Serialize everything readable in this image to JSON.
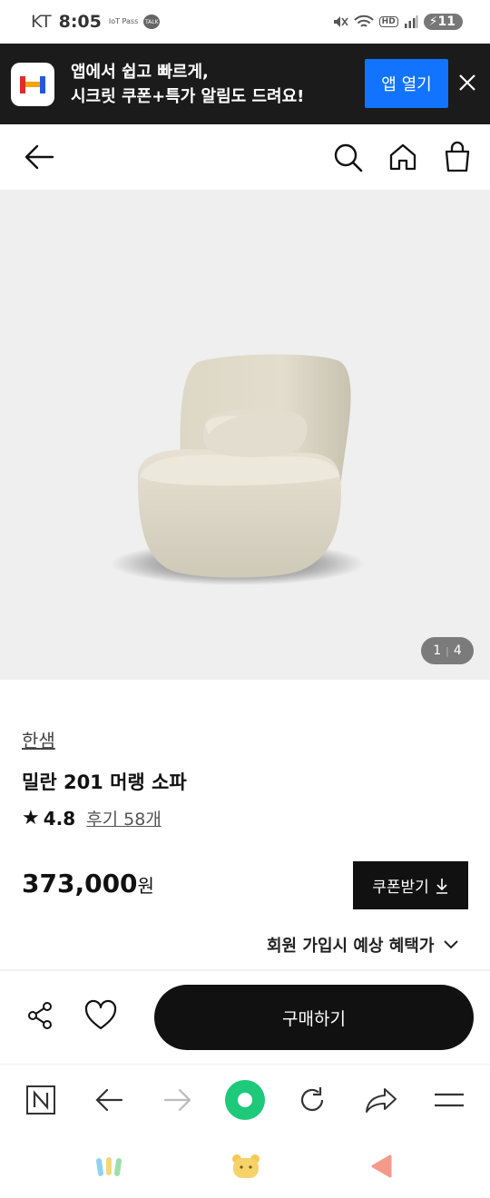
{
  "status_bar": {
    "carrier": "KT",
    "time": "8:05",
    "iot_icon_text": "IoT Pass",
    "talk_icon_text": "TALK",
    "hd_badge": "HD",
    "battery_level": "11"
  },
  "app_banner": {
    "line1": "앱에서 쉽고 빠르게,",
    "line2": "시크릿 쿠폰+특가 알림도 드려요!",
    "open_button": "앱 열기"
  },
  "product": {
    "brand": "한샘",
    "name": "밀란 201 머랭 소파",
    "rating": "4.8",
    "reviews": "후기 58개",
    "price": "373,000",
    "currency_unit": "원",
    "coupon_button": "쿠폰받기",
    "member_benefit": "회원 가입시 예상 혜택가"
  },
  "gallery": {
    "current": "1",
    "total": "4"
  },
  "actions": {
    "buy_button": "구매하기"
  },
  "colors": {
    "banner_bg": "#1b1b1b",
    "open_app_blue": "#1273ff",
    "buy_button_bg": "#111111",
    "browser_green": "#1ec97a"
  }
}
